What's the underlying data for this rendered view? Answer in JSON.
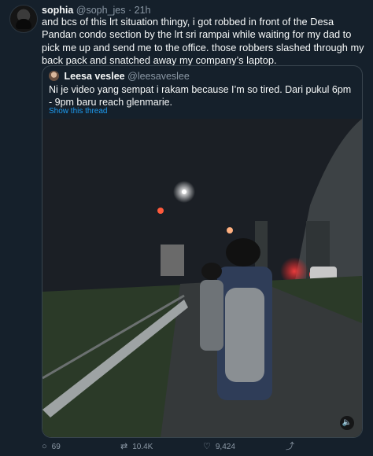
{
  "tweet": {
    "display_name": "sophia",
    "handle": "@soph_jes",
    "separator": "·",
    "time": "21h",
    "text": "and bcs of this lrt situation thingy, i got robbed in front of the Desa Pandan condo section by the lrt sri rampai while waiting for my dad to pick me up and send me to the office. those robbers slashed through my back pack and snatched away my company’s laptop."
  },
  "quoted": {
    "display_name": "Leesa veslee",
    "handle": "@leesaveslee",
    "text": "Ni je video yang sempat i rakam because I’m so tired. Dari pukul 6pm - 9pm baru reach glenmarie.",
    "show_thread": "Show this thread"
  },
  "actions": {
    "replies": "69",
    "retweets": "10.4K",
    "likes": "9,424"
  },
  "icons": {
    "reply": "comment-icon",
    "retweet": "retweet-icon",
    "like": "heart-icon",
    "share": "share-icon",
    "mute": "speaker-icon"
  },
  "colors": {
    "background": "#15202b",
    "link": "#1d9bf0",
    "muted": "#8b98a5"
  }
}
